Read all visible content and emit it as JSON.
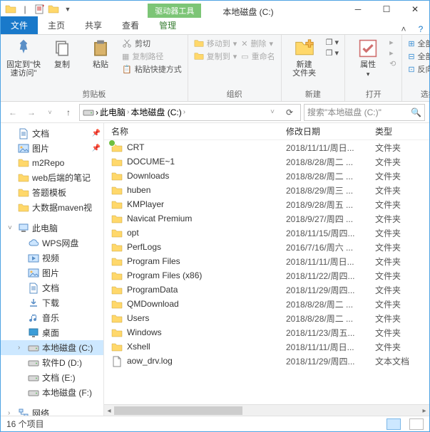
{
  "window": {
    "context_tab": "驱动器工具",
    "title": "本地磁盘 (C:)"
  },
  "tabs": {
    "file": "文件",
    "home": "主页",
    "share": "共享",
    "view": "查看",
    "manage": "管理"
  },
  "ribbon": {
    "pin": "固定到\"快\n速访问\"",
    "copy": "复制",
    "paste": "粘贴",
    "cut": "剪切",
    "copy_path": "复制路径",
    "paste_shortcut": "粘贴快捷方式",
    "clipboard_group": "剪贴板",
    "move_to": "移动到",
    "copy_to": "复制到",
    "delete": "删除",
    "rename": "重命名",
    "organize_group": "组织",
    "new_folder": "新建\n文件夹",
    "new_group": "新建",
    "properties": "属性",
    "open_group": "打开",
    "select_all": "全部选择",
    "select_none": "全部取消",
    "invert": "反向选择",
    "select_group": "选择"
  },
  "breadcrumb": {
    "pc": "此电脑",
    "drive": "本地磁盘 (C:)"
  },
  "search": {
    "placeholder": "搜索\"本地磁盘 (C:)\""
  },
  "tree": {
    "quick": [
      {
        "label": "文档",
        "icon": "doc"
      },
      {
        "label": "图片",
        "icon": "pic"
      },
      {
        "label": "m2Repo",
        "icon": "folder"
      },
      {
        "label": "web后端的笔记",
        "icon": "folder"
      },
      {
        "label": "答题模板",
        "icon": "folder"
      },
      {
        "label": "大数据maven视",
        "icon": "folder"
      }
    ],
    "pc_label": "此电脑",
    "pc_items": [
      {
        "label": "WPS网盘",
        "icon": "cloud"
      },
      {
        "label": "视频",
        "icon": "video"
      },
      {
        "label": "图片",
        "icon": "pic"
      },
      {
        "label": "文档",
        "icon": "doc"
      },
      {
        "label": "下载",
        "icon": "download"
      },
      {
        "label": "音乐",
        "icon": "music"
      },
      {
        "label": "桌面",
        "icon": "desktop"
      },
      {
        "label": "本地磁盘 (C:)",
        "icon": "drive",
        "selected": true
      },
      {
        "label": "软件D (D:)",
        "icon": "drive"
      },
      {
        "label": "文档 (E:)",
        "icon": "drive"
      },
      {
        "label": "本地磁盘 (F:)",
        "icon": "drive"
      }
    ],
    "network": "网络"
  },
  "columns": {
    "name": "名称",
    "modified": "修改日期",
    "type": "类型"
  },
  "files": [
    {
      "name": "CRT",
      "mod": "2018/11/11/周日...",
      "type": "文件夹",
      "icon": "folder",
      "badge": true
    },
    {
      "name": "DOCUME~1",
      "mod": "2018/8/28/周二 ...",
      "type": "文件夹",
      "icon": "folder"
    },
    {
      "name": "Downloads",
      "mod": "2018/8/28/周二 ...",
      "type": "文件夹",
      "icon": "folder"
    },
    {
      "name": "huben",
      "mod": "2018/8/29/周三 ...",
      "type": "文件夹",
      "icon": "folder"
    },
    {
      "name": "KMPlayer",
      "mod": "2018/9/28/周五 ...",
      "type": "文件夹",
      "icon": "folder"
    },
    {
      "name": "Navicat Premium",
      "mod": "2018/9/27/周四 ...",
      "type": "文件夹",
      "icon": "folder"
    },
    {
      "name": "opt",
      "mod": "2018/11/15/周四...",
      "type": "文件夹",
      "icon": "folder"
    },
    {
      "name": "PerfLogs",
      "mod": "2016/7/16/周六 ...",
      "type": "文件夹",
      "icon": "folder"
    },
    {
      "name": "Program Files",
      "mod": "2018/11/11/周日...",
      "type": "文件夹",
      "icon": "folder"
    },
    {
      "name": "Program Files (x86)",
      "mod": "2018/11/22/周四...",
      "type": "文件夹",
      "icon": "folder"
    },
    {
      "name": "ProgramData",
      "mod": "2018/11/29/周四...",
      "type": "文件夹",
      "icon": "folder"
    },
    {
      "name": "QMDownload",
      "mod": "2018/8/28/周二 ...",
      "type": "文件夹",
      "icon": "folder"
    },
    {
      "name": "Users",
      "mod": "2018/8/28/周二 ...",
      "type": "文件夹",
      "icon": "folder"
    },
    {
      "name": "Windows",
      "mod": "2018/11/23/周五...",
      "type": "文件夹",
      "icon": "folder"
    },
    {
      "name": "Xshell",
      "mod": "2018/11/11/周日...",
      "type": "文件夹",
      "icon": "folder"
    },
    {
      "name": "aow_drv.log",
      "mod": "2018/11/29/周四...",
      "type": "文本文档",
      "icon": "file"
    }
  ],
  "status": {
    "count": "16 个项目"
  }
}
